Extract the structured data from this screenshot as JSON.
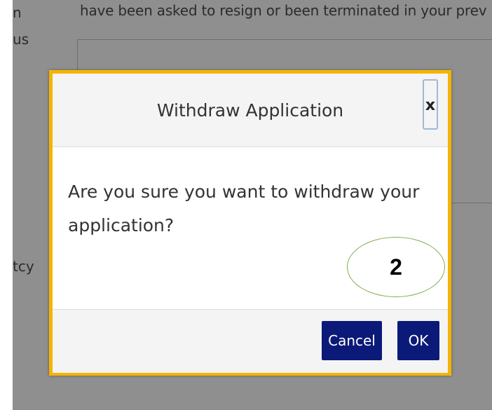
{
  "background": {
    "sentence": "have been asked to resign or been terminated in your prev",
    "fragments": [
      "n",
      "us",
      "tcy"
    ]
  },
  "dialog": {
    "title": "Withdraw Application",
    "close_label": "x",
    "message": "Are you sure you want to withdraw your application?",
    "cancel_label": "Cancel",
    "ok_label": "OK"
  },
  "callout": {
    "step": "2"
  },
  "colors": {
    "highlight_frame": "#f5b400",
    "button_bg": "#0b1a78",
    "callout_ring": "#7fae4d",
    "backdrop": "#8f8f8f"
  }
}
